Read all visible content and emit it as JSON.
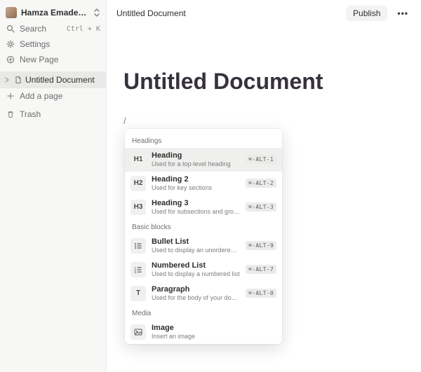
{
  "sidebar": {
    "workspace_name": "Hamza Emadee...",
    "search_label": "Search",
    "search_shortcut": "Ctrl + K",
    "settings_label": "Settings",
    "newpage_label": "New Page",
    "pages": [
      {
        "label": "Untitled Document",
        "active": true
      }
    ],
    "addpage_label": "Add a page",
    "trash_label": "Trash"
  },
  "topbar": {
    "breadcrumb": "Untitled Document",
    "publish_label": "Publish"
  },
  "document": {
    "title": "Untitled Document",
    "slash_char": "/"
  },
  "menu": {
    "groups": [
      {
        "label": "Headings",
        "items": [
          {
            "tile": "H1",
            "title": "Heading",
            "desc": "Used for a top-level heading",
            "shortcut": "⌘-ALT-1",
            "selected": true
          },
          {
            "tile": "H2",
            "title": "Heading 2",
            "desc": "Used for key sections",
            "shortcut": "⌘-ALT-2"
          },
          {
            "tile": "H3",
            "title": "Heading 3",
            "desc": "Used for subsections and group headings",
            "shortcut": "⌘-ALT-3"
          }
        ]
      },
      {
        "label": "Basic blocks",
        "items": [
          {
            "tile": "bullet",
            "title": "Bullet List",
            "desc": "Used to display an unordered list",
            "shortcut": "⌘-ALT-9"
          },
          {
            "tile": "numbered",
            "title": "Numbered List",
            "desc": "Used to display a numbered list",
            "shortcut": "⌘-ALT-7"
          },
          {
            "tile": "T",
            "title": "Paragraph",
            "desc": "Used for the body of your document",
            "shortcut": "⌘-ALT-0"
          }
        ]
      },
      {
        "label": "Media",
        "items": [
          {
            "tile": "image",
            "title": "Image",
            "desc": "Insert an image"
          }
        ]
      }
    ]
  }
}
